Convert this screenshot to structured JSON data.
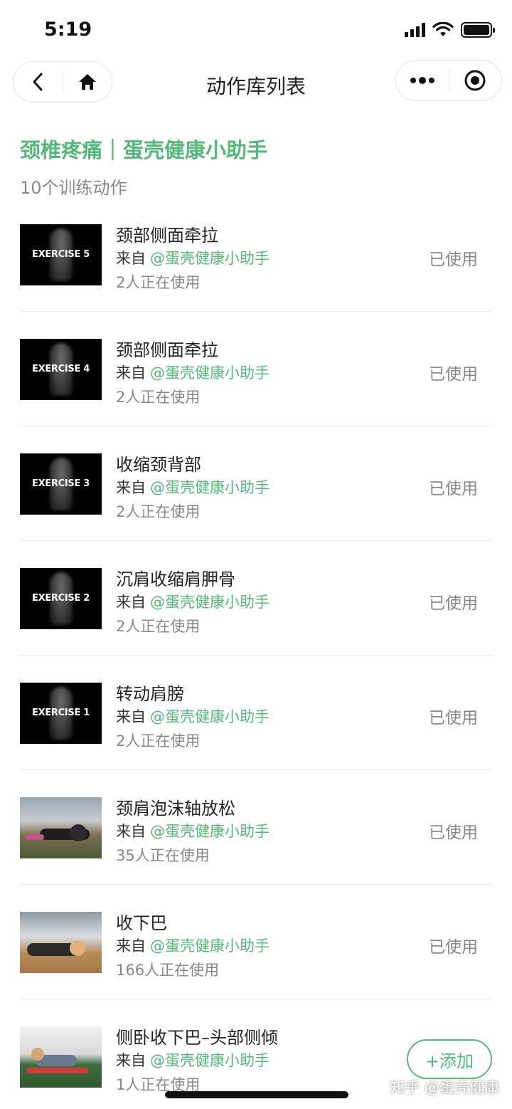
{
  "status_bar": {
    "time": "5:19"
  },
  "nav": {
    "title": "动作库列表"
  },
  "header": {
    "title": "颈椎疼痛｜蛋壳健康小助手",
    "count": "10个训练动作"
  },
  "items": [
    {
      "name": "颈部侧面牵拉",
      "from_prefix": "来自",
      "author": "@蛋壳健康小助手",
      "users": "2人正在使用",
      "status": "已使用",
      "thumb_label": "EXERCISE 5"
    },
    {
      "name": "颈部侧面牵拉",
      "from_prefix": "来自",
      "author": "@蛋壳健康小助手",
      "users": "2人正在使用",
      "status": "已使用",
      "thumb_label": "EXERCISE 4"
    },
    {
      "name": "收缩颈背部",
      "from_prefix": "来自",
      "author": "@蛋壳健康小助手",
      "users": "2人正在使用",
      "status": "已使用",
      "thumb_label": "EXERCISE 3"
    },
    {
      "name": "沉肩收缩肩胛骨",
      "from_prefix": "来自",
      "author": "@蛋壳健康小助手",
      "users": "2人正在使用",
      "status": "已使用",
      "thumb_label": "EXERCISE 2"
    },
    {
      "name": "转动肩膀",
      "from_prefix": "来自",
      "author": "@蛋壳健康小助手",
      "users": "2人正在使用",
      "status": "已使用",
      "thumb_label": "EXERCISE 1"
    },
    {
      "name": "颈肩泡沫轴放松",
      "from_prefix": "来自",
      "author": "@蛋壳健康小助手",
      "users": "35人正在使用",
      "status": "已使用"
    },
    {
      "name": "收下巴",
      "from_prefix": "来自",
      "author": "@蛋壳健康小助手",
      "users": "166人正在使用",
      "status": "已使用"
    },
    {
      "name": "侧卧收下巴–头部侧倾",
      "from_prefix": "来自",
      "author": "@蛋壳健康小助手",
      "users": "1人正在使用",
      "action": "+添加"
    }
  ],
  "watermark": "知乎 @蛋壳健康",
  "colors": {
    "accent": "#52b979",
    "muted": "#888888"
  },
  "icons": {
    "back": "chevron-left-icon",
    "home": "home-icon",
    "more": "more-dots-icon",
    "close": "target-circle-icon"
  }
}
